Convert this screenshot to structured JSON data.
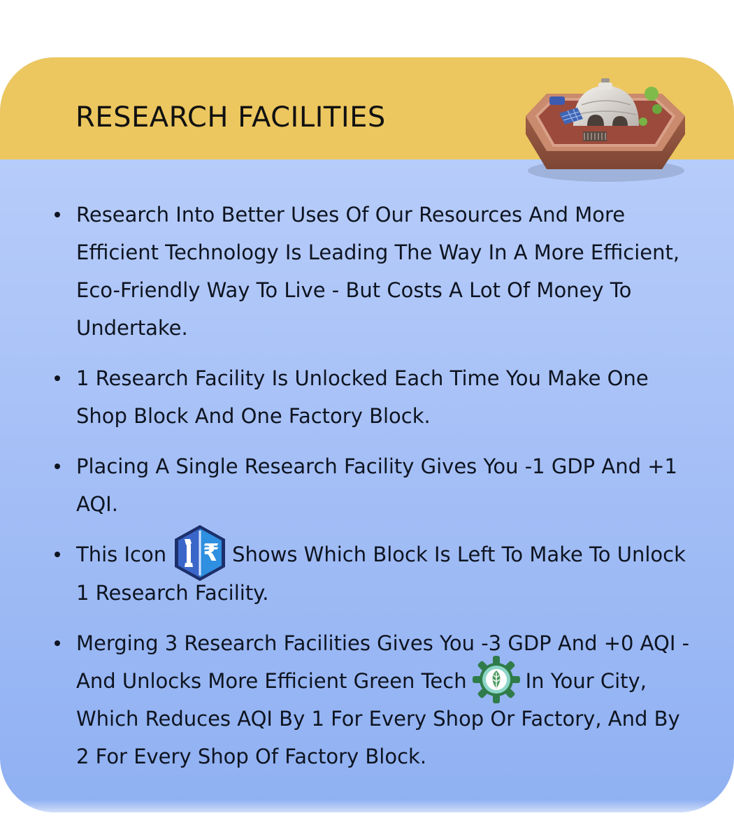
{
  "card": {
    "title": "RESEARCH FACILITIES",
    "header_color": "#ecc75f",
    "body_gradient": [
      "#bcd0fb",
      "#8fb0f2"
    ],
    "illustration": "research-facility-dome-icon"
  },
  "bullets": [
    {
      "text": "Research Into Better Uses Of Our Resources And More Efficient Technology Is Leading The Way In A More Efficient, Eco-Friendly Way To Live - But Costs A Lot Of Money To Undertake."
    },
    {
      "text": "1 Research Facility Is Unlocked Each Time You Make One Shop Block And One Factory Block."
    },
    {
      "text": "Placing A Single Research Facility Gives You -1 GDP And +1 AQI."
    },
    {
      "before": "This Icon",
      "icon": "wrench-rupee-icon",
      "after": "Shows Which Block Is Left To Make To Unlock 1 Research Facility."
    },
    {
      "before": "Merging 3 Research Facilities Gives You -3 GDP And +0 AQI - And Unlocks More Efficient Green Tech",
      "icon": "green-tech-leaf-gear-icon",
      "after": "In Your City, Which Reduces AQI By 1 For Every Shop Or Factory, And By 2 For Every Shop Of Factory Block."
    }
  ]
}
